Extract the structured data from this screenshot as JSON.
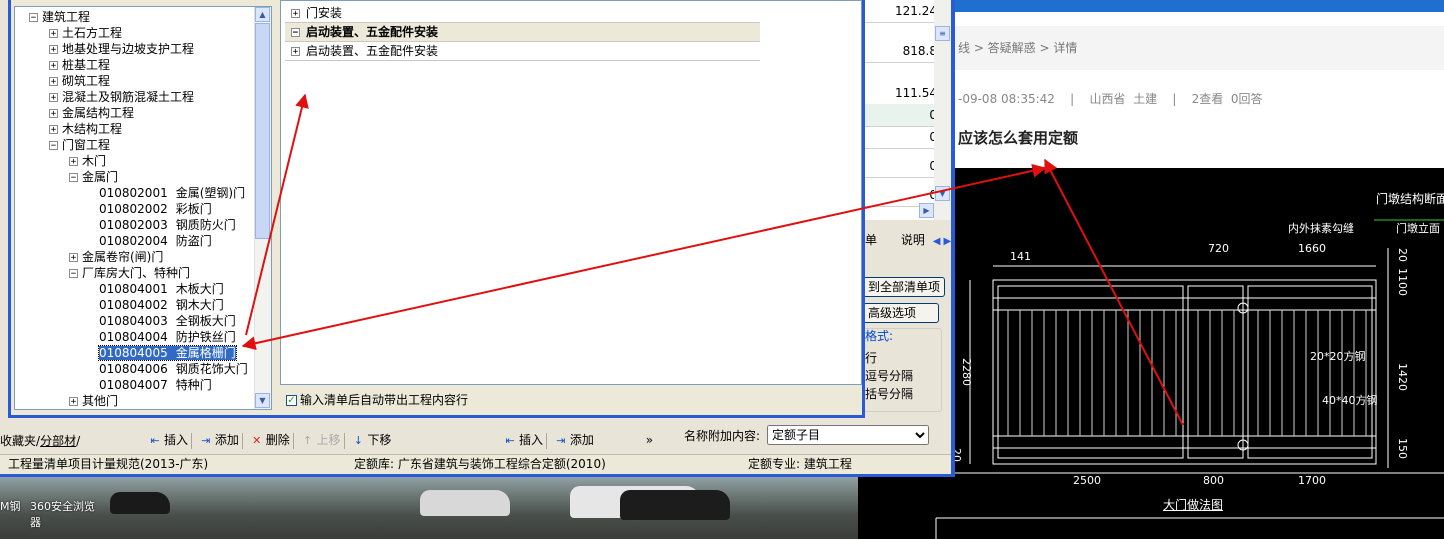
{
  "desktop": {
    "icons": [
      {
        "label": "M钢"
      },
      {
        "label": "360安全浏览器"
      }
    ]
  },
  "web": {
    "breadcrumb": "线 > 答疑解惑 > 详情",
    "meta": "-09-08 08:35:42    |    山西省  土建    |    2查看  0回答",
    "question_title": "应该怎么套用定额",
    "colors": {
      "nav": "#1f6fd0"
    }
  },
  "cad": {
    "title_right": "门墩结构断面",
    "subtitle": "门墩立面",
    "label_inner": "内外抹素勾缝",
    "dim_top": [
      "141",
      "720",
      "1660"
    ],
    "dim_bottom": [
      "2500",
      "800",
      "1700"
    ],
    "dim_left": "2280",
    "dim_left_small": "20",
    "dim_right": [
      "1100",
      "1420",
      "150",
      "20"
    ],
    "steel1": "20*20方钢",
    "steel2": "40*40方钢",
    "caption": "大门做法图"
  },
  "tree": {
    "items": [
      {
        "depth": 0,
        "toggle": "−",
        "label": "建筑工程"
      },
      {
        "depth": 1,
        "toggle": "+",
        "label": "土石方工程"
      },
      {
        "depth": 1,
        "toggle": "+",
        "label": "地基处理与边坡支护工程"
      },
      {
        "depth": 1,
        "toggle": "+",
        "label": "桩基工程"
      },
      {
        "depth": 1,
        "toggle": "+",
        "label": "砌筑工程"
      },
      {
        "depth": 1,
        "toggle": "+",
        "label": "混凝土及钢筋混凝土工程"
      },
      {
        "depth": 1,
        "toggle": "+",
        "label": "金属结构工程"
      },
      {
        "depth": 1,
        "toggle": "+",
        "label": "木结构工程"
      },
      {
        "depth": 1,
        "toggle": "−",
        "label": "门窗工程"
      },
      {
        "depth": 2,
        "toggle": "+",
        "label": "木门"
      },
      {
        "depth": 2,
        "toggle": "−",
        "label": "金属门"
      },
      {
        "depth": 3,
        "code": "010802001",
        "label": "金属(塑钢)门"
      },
      {
        "depth": 3,
        "code": "010802002",
        "label": "彩板门"
      },
      {
        "depth": 3,
        "code": "010802003",
        "label": "钢质防火门"
      },
      {
        "depth": 3,
        "code": "010802004",
        "label": "防盗门"
      },
      {
        "depth": 2,
        "toggle": "+",
        "label": "金属卷帘(闸)门"
      },
      {
        "depth": 2,
        "toggle": "−",
        "label": "厂库房大门、特种门"
      },
      {
        "depth": 3,
        "code": "010804001",
        "label": "木板大门"
      },
      {
        "depth": 3,
        "code": "010804002",
        "label": "钢木大门"
      },
      {
        "depth": 3,
        "code": "010804003",
        "label": "全钢板大门"
      },
      {
        "depth": 3,
        "code": "010804004",
        "label": "防护铁丝门"
      },
      {
        "depth": 3,
        "code": "010804005",
        "label": "金属格栅门",
        "selected": true
      },
      {
        "depth": 3,
        "code": "010804006",
        "label": "钢质花饰大门"
      },
      {
        "depth": 3,
        "code": "010804007",
        "label": "特种门"
      },
      {
        "depth": 2,
        "toggle": "+",
        "label": "其他门"
      }
    ]
  },
  "grid": {
    "rows": [
      {
        "toggle": "+",
        "label": "门安装",
        "group": false
      },
      {
        "toggle": "−",
        "label": "启动装置、五金配件安装",
        "group": true
      },
      {
        "toggle": "+",
        "label": "启动装置、五金配件安装",
        "group": false
      }
    ],
    "auto_check_label": "输入清单后自动带出工程内容行"
  },
  "numbers": [
    "121.24",
    "818.8",
    "111.54",
    "0",
    "0",
    "0",
    "0"
  ],
  "right_panel": {
    "tab1": "单",
    "tab2": "说明",
    "btn_all": "到全部清单项",
    "btn_adv": "高级选项",
    "group_title": "格式:",
    "opt1": "行",
    "opt2": "逗号分隔",
    "opt3": "括号分隔",
    "append_label": "名称附加内容:",
    "append_value": "定额子目"
  },
  "toolbar_left": {
    "insert": "插入",
    "add": "添加",
    "delete": "删除",
    "up": "上移",
    "down": "下移"
  },
  "toolbar_mid": {
    "insert": "插入",
    "add": "添加",
    "more": "»"
  },
  "bottom_tabs": {
    "fav": "收藏夹",
    "part": "分部材"
  },
  "status": {
    "spec": "工程量清单项目计量规范(2013-广东)",
    "quota_lib": "定额库: 广东省建筑与装饰工程综合定额(2010)",
    "quota_major": "定额专业: 建筑工程"
  }
}
